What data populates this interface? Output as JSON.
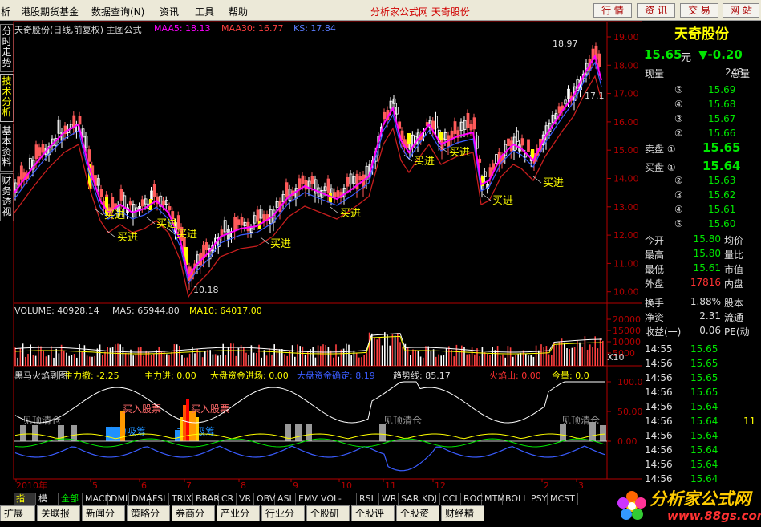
{
  "menu": {
    "items": [
      "析",
      "港股期货基金",
      "数据查询(N)",
      "资讯",
      "工具",
      "帮助"
    ],
    "brand": "分析家公式网  天奇股份",
    "buttons": [
      "行 情",
      "资 讯",
      "交 易",
      "网 站"
    ]
  },
  "left_tabs": [
    "分时走势",
    "技术分析",
    "基本资料",
    "财务透视"
  ],
  "main_chart": {
    "legend": {
      "title": "天奇股份(日线,前复权) 主图公式",
      "ma5": "MAA5: 18.13",
      "ma30": "MAA30: 16.77",
      "ks": "KS: 17.84"
    },
    "y_ticks": [
      "19.00",
      "18.00",
      "17.00",
      "16.00",
      "15.00",
      "14.00",
      "13.00",
      "12.00",
      "11.00",
      "10.00"
    ],
    "annotations": {
      "high": "18.97",
      "right": "17.1",
      "low": "10.18",
      "buy": "买进"
    }
  },
  "volume_chart": {
    "legend": {
      "volume": "VOLUME: 40928.14",
      "ma5": "MA5: 65944.80",
      "ma10": "MA10: 64017.00"
    },
    "y_ticks": [
      "20000",
      "15000",
      "10000",
      "5000"
    ],
    "unit": "X10"
  },
  "indicator_chart": {
    "legend": {
      "name": "黑马火焰副图",
      "main_retreat": "主力撤: -2.25",
      "main_in": "主力进: 0.00",
      "big_in": "大盘资金进场: 0.00",
      "big_conf": "大盘资金确定: 8.19",
      "trend": "趋势线: 85.17",
      "fire": "火焰山: 0.00",
      "today": "今量: 0.0"
    },
    "y_ticks": [
      "100.00",
      "50.00",
      "0.00"
    ],
    "labels": {
      "buy": "买入股票",
      "top_clear": "见顶清仓",
      "absorb": "主力吸筹"
    }
  },
  "x_axis": {
    "labels": [
      "2010年",
      "5",
      "6",
      "7",
      "8",
      "9",
      "10",
      "11",
      "12",
      "2",
      "3"
    ]
  },
  "quote": {
    "name": "天奇股份",
    "price": "15.65",
    "price_unit": "元",
    "change": "▼-0.20",
    "volume_label": "现量",
    "volume": "248",
    "total_label": "总量",
    "asks": [
      {
        "lvl": "⑤",
        "price": "15.69"
      },
      {
        "lvl": "④",
        "price": "15.68"
      },
      {
        "lvl": "③",
        "price": "15.67"
      },
      {
        "lvl": "②",
        "price": "15.66"
      },
      {
        "lvl": "卖盘 ①",
        "price": "15.65"
      }
    ],
    "bids": [
      {
        "lvl": "买盘 ①",
        "price": "15.64"
      },
      {
        "lvl": "②",
        "price": "15.63"
      },
      {
        "lvl": "③",
        "price": "15.62"
      },
      {
        "lvl": "④",
        "price": "15.61"
      },
      {
        "lvl": "⑤",
        "price": "15.60"
      }
    ],
    "stats": [
      {
        "k": "今开",
        "v": "15.80",
        "k2": "均价"
      },
      {
        "k": "最高",
        "v": "15.80",
        "k2": "量比"
      },
      {
        "k": "最低",
        "v": "15.61",
        "k2": "市值"
      },
      {
        "k": "外盘",
        "v": "17816",
        "k2": "内盘"
      },
      {
        "k": "换手",
        "v": "1.88%",
        "k2": "股本"
      },
      {
        "k": "净资",
        "v": "2.31",
        "k2": "流通"
      },
      {
        "k": "收益(一)",
        "v": "0.06",
        "k2": "PE(动"
      }
    ],
    "ticks": [
      {
        "t": "14:55",
        "p": "15.65",
        "v": ""
      },
      {
        "t": "14:56",
        "p": "15.65",
        "v": ""
      },
      {
        "t": "14:56",
        "p": "15.65",
        "v": ""
      },
      {
        "t": "14:56",
        "p": "15.65",
        "v": ""
      },
      {
        "t": "14:56",
        "p": "15.64",
        "v": ""
      },
      {
        "t": "14:56",
        "p": "15.64",
        "v": "11"
      },
      {
        "t": "14:56",
        "p": "15.64",
        "v": ""
      },
      {
        "t": "14:56",
        "p": "15.64",
        "v": ""
      },
      {
        "t": "14:56",
        "p": "15.64",
        "v": ""
      },
      {
        "t": "14:56",
        "p": "15.64",
        "v": ""
      }
    ]
  },
  "indicator_tabs": [
    "指标",
    "模板",
    "全部",
    "MACD",
    "DMI",
    "DMA",
    "FSL",
    "TRIX",
    "BRAR",
    "CR",
    "VR",
    "OBV",
    "ASI",
    "EMV",
    "VOL-TDX",
    "RSI",
    "WR",
    "SAR",
    "KDJ",
    "CCI",
    "ROC",
    "MTM",
    "BOLL",
    "PSY",
    "MCST"
  ],
  "bottom_tabs": [
    "扩展区",
    "关联报价",
    "新闻分析",
    "策略分析",
    "券商分析",
    "产业分析",
    "行业分析",
    "个股研报",
    "个股评级",
    "个股资讯",
    "财经精选"
  ],
  "watermark": {
    "text": "分析家公式网",
    "url": "www.88gs.com"
  },
  "colors": {
    "up": "#ff3232",
    "down": "#00e600",
    "ma5": "#ff00ff",
    "ma30": "#c81e1e",
    "ks": "#3a5cff",
    "candle_up": "#ff5a5a",
    "candle_mark": "#ffff00",
    "text_yellow": "#ffff00",
    "axis": "#b40000"
  }
}
